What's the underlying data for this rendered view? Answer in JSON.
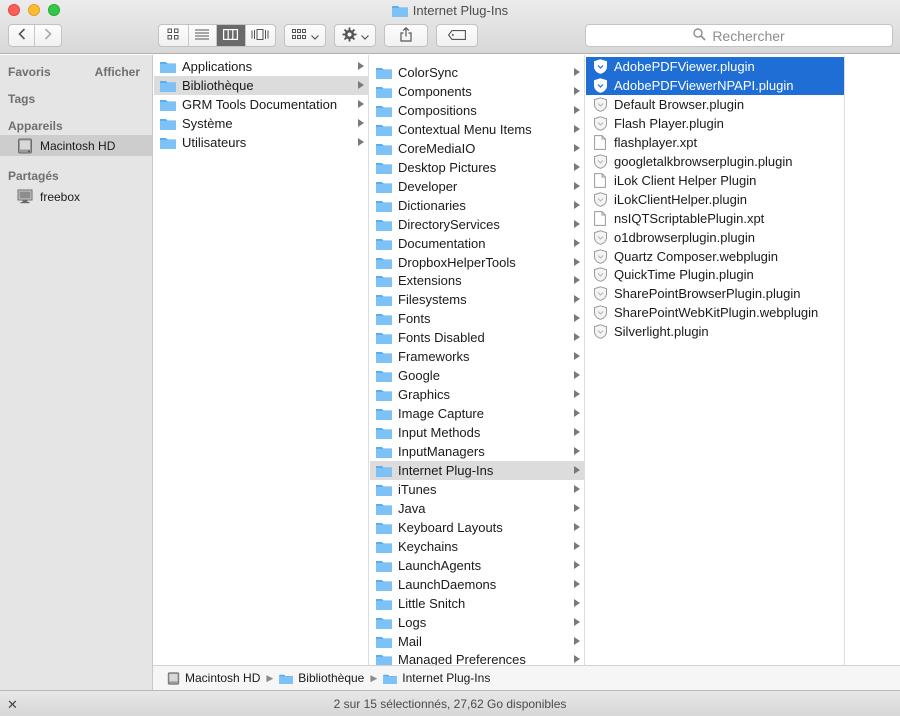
{
  "window": {
    "title": "Internet Plug-Ins"
  },
  "toolbar": {
    "search_placeholder": "Rechercher",
    "accent_color": "#1f6ed6"
  },
  "sidebar": {
    "favorites_label": "Favoris",
    "show_label": "Afficher",
    "tags_label": "Tags",
    "devices_label": "Appareils",
    "devices": [
      {
        "label": "Macintosh HD",
        "icon": "hard-drive-icon",
        "selected": true
      }
    ],
    "shared_label": "Partagés",
    "shared": [
      {
        "label": "freebox",
        "icon": "monitor-icon"
      }
    ]
  },
  "column1": [
    {
      "label": "Applications"
    },
    {
      "label": "Bibliothèque",
      "selected": true
    },
    {
      "label": "GRM Tools Documentation"
    },
    {
      "label": "Système"
    },
    {
      "label": "Utilisateurs"
    }
  ],
  "column2": [
    {
      "label": "ColorSync"
    },
    {
      "label": "Components"
    },
    {
      "label": "Compositions"
    },
    {
      "label": "Contextual Menu Items"
    },
    {
      "label": "CoreMediaIO"
    },
    {
      "label": "Desktop Pictures"
    },
    {
      "label": "Developer"
    },
    {
      "label": "Dictionaries"
    },
    {
      "label": "DirectoryServices"
    },
    {
      "label": "Documentation"
    },
    {
      "label": "DropboxHelperTools"
    },
    {
      "label": "Extensions"
    },
    {
      "label": "Filesystems"
    },
    {
      "label": "Fonts"
    },
    {
      "label": "Fonts Disabled"
    },
    {
      "label": "Frameworks"
    },
    {
      "label": "Google"
    },
    {
      "label": "Graphics"
    },
    {
      "label": "Image Capture"
    },
    {
      "label": "Input Methods"
    },
    {
      "label": "InputManagers"
    },
    {
      "label": "Internet Plug-Ins",
      "selected": true
    },
    {
      "label": "iTunes"
    },
    {
      "label": "Java"
    },
    {
      "label": "Keyboard Layouts"
    },
    {
      "label": "Keychains"
    },
    {
      "label": "LaunchAgents"
    },
    {
      "label": "LaunchDaemons"
    },
    {
      "label": "Little Snitch"
    },
    {
      "label": "Logs"
    },
    {
      "label": "Mail"
    },
    {
      "label": "Managed Preferences"
    }
  ],
  "column3": [
    {
      "label": "AdobePDFViewer.plugin",
      "icon": "plugin",
      "selected": true
    },
    {
      "label": "AdobePDFViewerNPAPI.plugin",
      "icon": "plugin",
      "selected": true
    },
    {
      "label": "Default Browser.plugin",
      "icon": "plugin"
    },
    {
      "label": "Flash Player.plugin",
      "icon": "plugin"
    },
    {
      "label": "flashplayer.xpt",
      "icon": "doc"
    },
    {
      "label": "googletalkbrowserplugin.plugin",
      "icon": "plugin"
    },
    {
      "label": "iLok Client Helper Plugin",
      "icon": "doc"
    },
    {
      "label": "iLokClientHelper.plugin",
      "icon": "plugin"
    },
    {
      "label": "nsIQTScriptablePlugin.xpt",
      "icon": "doc"
    },
    {
      "label": "o1dbrowserplugin.plugin",
      "icon": "plugin"
    },
    {
      "label": "Quartz Composer.webplugin",
      "icon": "plugin"
    },
    {
      "label": "QuickTime Plugin.plugin",
      "icon": "plugin"
    },
    {
      "label": "SharePointBrowserPlugin.plugin",
      "icon": "plugin"
    },
    {
      "label": "SharePointWebKitPlugin.webplugin",
      "icon": "plugin"
    },
    {
      "label": "Silverlight.plugin",
      "icon": "plugin"
    }
  ],
  "pathbar": [
    {
      "label": "Macintosh HD",
      "icon": "hard-drive-icon"
    },
    {
      "label": "Bibliothèque",
      "icon": "folder-icon"
    },
    {
      "label": "Internet Plug-Ins",
      "icon": "folder-icon"
    }
  ],
  "status": {
    "text": "2 sur 15 sélectionnés, 27,62 Go disponibles"
  }
}
